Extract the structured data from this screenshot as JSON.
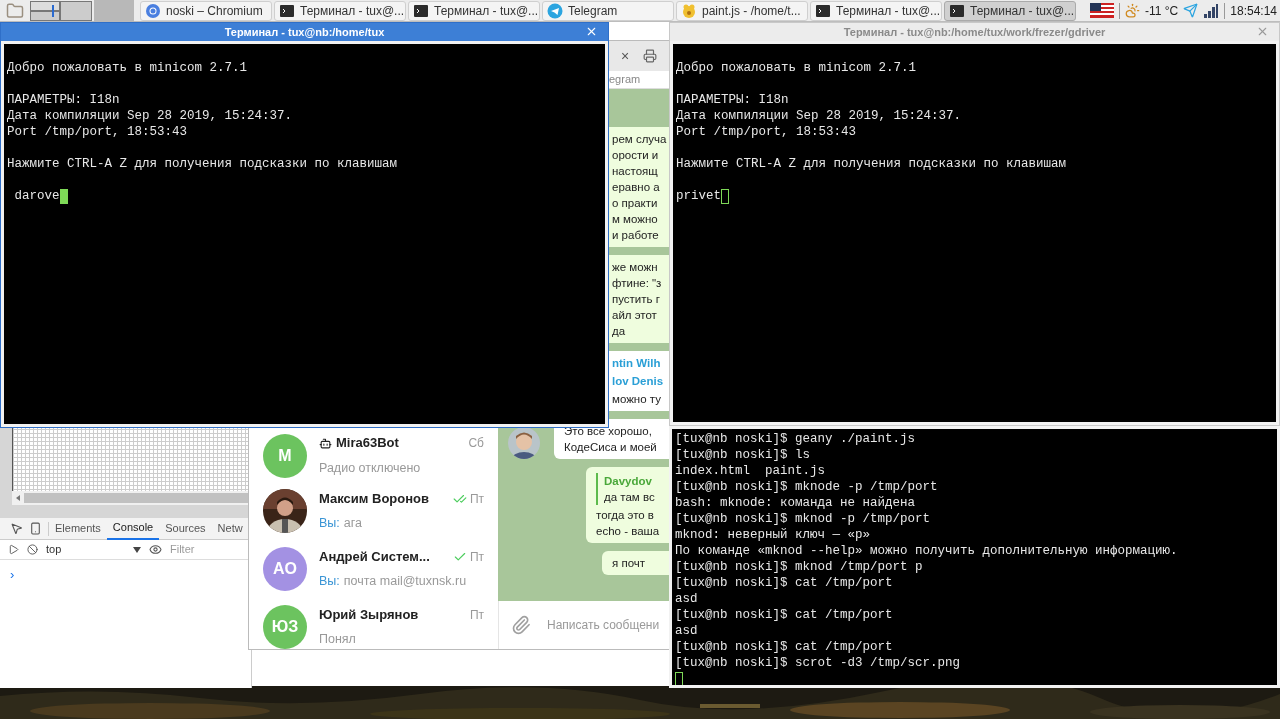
{
  "taskbar": {
    "tasks": [
      {
        "kind": "browser",
        "label": "noski – Chromium",
        "selected": false
      },
      {
        "kind": "terminal",
        "label": "Терминал - tux@...",
        "selected": false
      },
      {
        "kind": "terminal",
        "label": "Терминал - tux@...",
        "selected": false
      },
      {
        "kind": "telegram",
        "label": "Telegram",
        "selected": false
      },
      {
        "kind": "editor",
        "label": "paint.js - /home/t...",
        "selected": false
      },
      {
        "kind": "terminal",
        "label": "Терминал - tux@...",
        "selected": false
      },
      {
        "kind": "terminal",
        "label": "Терминал - tux@...",
        "selected": true
      }
    ],
    "temperature": "-11 °C",
    "clock": "18:54:14"
  },
  "chromium": {
    "devtools_tabs": [
      {
        "label": "Elements",
        "selected": false
      },
      {
        "label": "Console",
        "selected": true
      },
      {
        "label": "Sources",
        "selected": false
      },
      {
        "label": "Netw",
        "selected": false
      }
    ],
    "context": "top",
    "filter_placeholder": "Filter",
    "prompt": "›"
  },
  "telegram": {
    "tab_close": "×",
    "tab_title": "egram",
    "bubbles": [
      {
        "kind": "outgoing",
        "lines": [
          "рем случа",
          "орости и",
          "настоящ",
          "еравно а",
          "о практи",
          "м можно",
          "и работе"
        ]
      },
      {
        "kind": "outgoing",
        "lines": [
          "же можн",
          "фтине: \"з",
          "пустить г",
          "айл этот",
          "да"
        ]
      },
      {
        "kind": "forwarded",
        "author": "ntin Wilh",
        "quote_author": "lov Denis",
        "lines": [
          "можно ту"
        ]
      },
      {
        "kind": "incoming",
        "lines": [
          "Это все хорошо,",
          "КодеСиса и моей"
        ]
      },
      {
        "kind": "reply",
        "quote_author": "Davydov",
        "quote": "да там вс",
        "lines": [
          "тогда это в",
          "echo - ваша"
        ]
      },
      {
        "kind": "outgoing",
        "lines": [
          "я почт"
        ]
      }
    ],
    "composer_placeholder": "Написать сообщени",
    "chats": [
      {
        "avatar": {
          "kind": "initials",
          "initials": "M",
          "color": "#6cc35f"
        },
        "bot": true,
        "name": "Mira63Bot",
        "date": "Сб",
        "delivered": false,
        "read": false,
        "preview": "Радио отключено"
      },
      {
        "bot": false,
        "name": "Максим Воронов",
        "date": "Пт",
        "delivered": true,
        "read": true,
        "sender": "Вы:",
        "preview": "ага"
      },
      {
        "avatar": {
          "kind": "initials",
          "initials": "АО",
          "color": "#a391e3"
        },
        "bot": false,
        "name": "Андрей Систем...",
        "date": "Пт",
        "delivered": true,
        "read": false,
        "sender": "Вы:",
        "preview": "почта mail@tuxnsk.ru"
      },
      {
        "avatar": {
          "kind": "initials",
          "initials": "ЮЗ",
          "color": "#6cc35f"
        },
        "bot": false,
        "name": "Юрий Зырянов",
        "date": "Пт",
        "delivered": false,
        "read": false,
        "preview": "Понял"
      }
    ]
  },
  "terminals": [
    {
      "title": "Терминал - tux@nb:/home/tux",
      "focused": true,
      "blocks": [
        [
          "Добро пожаловать в minicom 2.7.1"
        ],
        [
          "ПАРАМЕТРЫ: I18n",
          "Дата компиляции Sep 28 2019, 15:24:37.",
          "Port /tmp/port, 18:53:43"
        ],
        [
          "Нажмите CTRL-A Z для получения подсказки по клавишам"
        ]
      ],
      "input": " darove"
    },
    {
      "title": "Терминал - tux@nb:/home/tux/work/frezer/gdriver",
      "focused": false,
      "blocks": [
        [
          "Добро пожаловать в minicom 2.7.1"
        ],
        [
          "ПАРАМЕТРЫ: I18n",
          "Дата компиляции Sep 28 2019, 15:24:37.",
          "Port /tmp/port, 18:53:43"
        ],
        [
          "Нажмите CTRL-A Z для получения подсказки по клавишам"
        ]
      ],
      "input": "privet"
    },
    {
      "focused": false,
      "blocks": [
        [
          "[tux@nb noski]$ geany ./paint.js",
          "[tux@nb noski]$ ls",
          "index.html  paint.js",
          "[tux@nb noski]$ mknode -p /tmp/port",
          "bash: mknode: команда не найдена",
          "[tux@nb noski]$ mknod -p /tmp/port",
          "mknod: неверный ключ — «p»",
          "По команде «mknod --help» можно получить дополнительную информацию.",
          "[tux@nb noski]$ mknod /tmp/port p",
          "[tux@nb noski]$ cat /tmp/port",
          "asd",
          "[tux@nb noski]$ cat /tmp/port",
          "asd",
          "[tux@nb noski]$ cat /tmp/port",
          "[tux@nb noski]$ scrot -d3 /tmp/scr.png"
        ]
      ]
    }
  ]
}
